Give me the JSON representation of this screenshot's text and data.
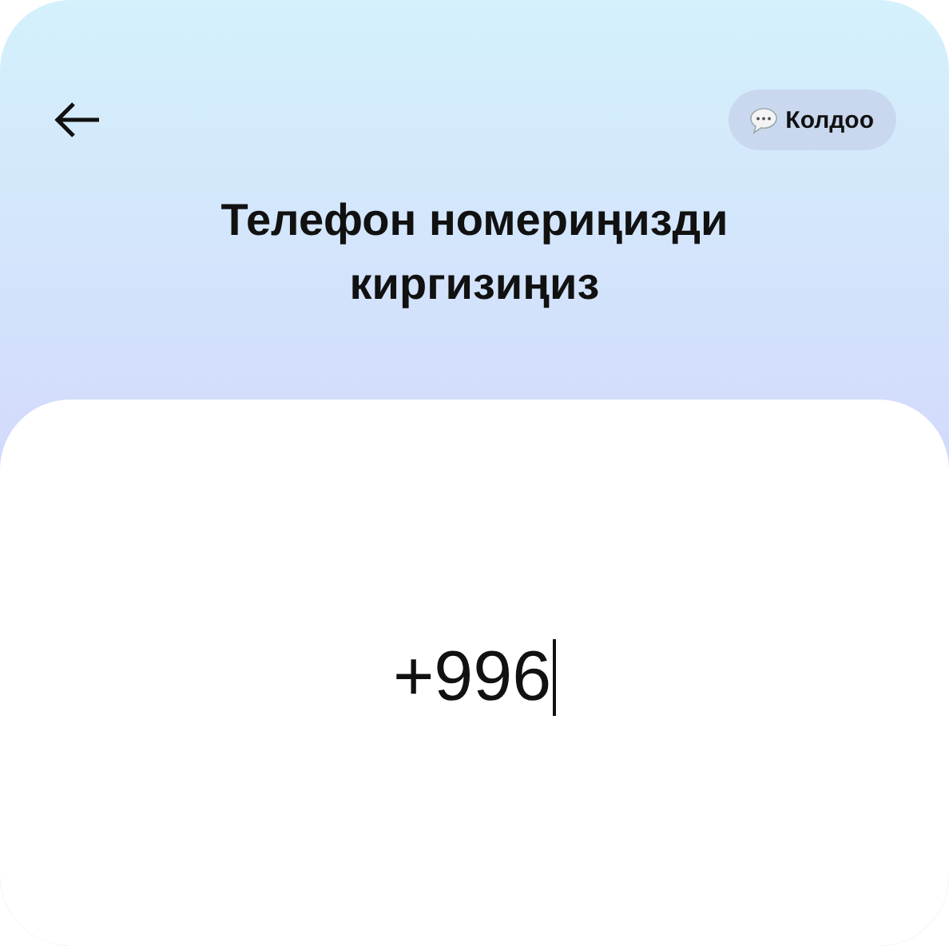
{
  "header": {
    "help_button": {
      "label": "Колдоо"
    }
  },
  "title": "Телефон номериңизди киргизиңиз",
  "phone_field": {
    "value": "+996"
  }
}
